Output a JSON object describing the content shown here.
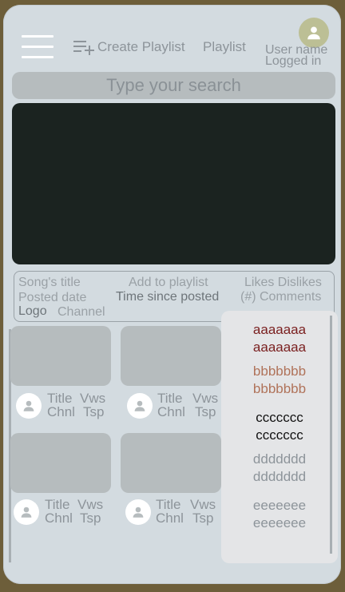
{
  "header": {
    "create_playlist": "Create Playlist",
    "playlist": "Playlist",
    "user_line1": "User name",
    "user_line2": "Logged in"
  },
  "search": {
    "placeholder": "Type your search"
  },
  "info": {
    "song_title": "Song's title",
    "add_to_playlist": "Add to playlist",
    "likes_dislikes": "Likes Dislikes",
    "posted_date": "Posted date",
    "time_since_posted": "Time since posted",
    "comments": "(#) Comments",
    "logo": "Logo",
    "channel": "Channel"
  },
  "videos": [
    {
      "title": "Title",
      "views": "Vws",
      "channel": "Chnl",
      "timestamp": "Tsp"
    },
    {
      "title": "Title",
      "views": "Vws",
      "channel": "Chnl",
      "timestamp": "Tsp"
    },
    {
      "title": "Title",
      "views": "Vws",
      "channel": "Chnl",
      "timestamp": "Tsp"
    },
    {
      "title": "Title",
      "views": "Vws",
      "channel": "Chnl",
      "timestamp": "Tsp"
    }
  ],
  "dropdown": {
    "items": [
      {
        "line1": "aaaaaaa",
        "line2": "aaaaaaa",
        "color": "#7a1f1f"
      },
      {
        "line1": "bbbbbbb",
        "line2": "bbbbbbb",
        "color": "#b0735a"
      },
      {
        "line1": "ccccccc",
        "line2": "ccccccc",
        "color": "#111111"
      },
      {
        "line1": "ddddddd",
        "line2": "ddddddd",
        "color": "#8d949a"
      },
      {
        "line1": "eeeeeee",
        "line2": "eeeeeee",
        "color": "#8d949a"
      }
    ]
  },
  "colors": {
    "background": "#6d5e3a",
    "panel": "#d3dbe0",
    "video": "#1b2320",
    "muted_text": "#8d949a",
    "avatar_top": "#bcbf95"
  }
}
